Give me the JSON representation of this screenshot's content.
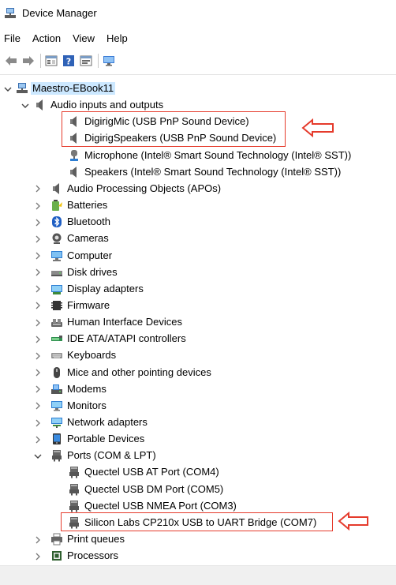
{
  "window": {
    "title": "Device Manager"
  },
  "menu": [
    "File",
    "Action",
    "View",
    "Help"
  ],
  "toolbar": [
    "back-arrow-icon",
    "forward-arrow-icon",
    "properties-icon",
    "help-icon",
    "show-hidden-icon",
    "monitor-icon"
  ],
  "tree": {
    "root": "Maestro-EBook11",
    "audio": {
      "label": "Audio inputs and outputs",
      "children": [
        "DigirigMic (USB PnP Sound Device)",
        "DigirigSpeakers (USB PnP Sound Device)",
        "Microphone (Intel® Smart Sound Technology (Intel® SST))",
        "Speakers (Intel® Smart Sound Technology (Intel® SST))"
      ]
    },
    "categories_a": [
      {
        "label": "Audio Processing Objects (APOs)",
        "icon": "speaker-icon"
      },
      {
        "label": "Batteries",
        "icon": "battery-icon"
      },
      {
        "label": "Bluetooth",
        "icon": "bluetooth-icon"
      },
      {
        "label": "Cameras",
        "icon": "camera-icon"
      },
      {
        "label": "Computer",
        "icon": "computer-icon"
      },
      {
        "label": "Disk drives",
        "icon": "disk-drive-icon"
      },
      {
        "label": "Display adapters",
        "icon": "display-adapter-icon"
      },
      {
        "label": "Firmware",
        "icon": "firmware-icon"
      },
      {
        "label": "Human Interface Devices",
        "icon": "hid-icon"
      },
      {
        "label": "IDE ATA/ATAPI controllers",
        "icon": "ide-controller-icon"
      },
      {
        "label": "Keyboards",
        "icon": "keyboard-icon"
      },
      {
        "label": "Mice and other pointing devices",
        "icon": "mouse-icon"
      },
      {
        "label": "Modems",
        "icon": "modem-icon"
      },
      {
        "label": "Monitors",
        "icon": "monitor-icon"
      },
      {
        "label": "Network adapters",
        "icon": "network-adapter-icon"
      },
      {
        "label": "Portable Devices",
        "icon": "portable-device-icon"
      }
    ],
    "ports": {
      "label": "Ports (COM & LPT)",
      "children": [
        "Quectel USB AT Port (COM4)",
        "Quectel USB DM Port (COM5)",
        "Quectel USB NMEA Port (COM3)",
        "Silicon Labs CP210x USB to UART Bridge (COM7)"
      ]
    },
    "categories_b": [
      {
        "label": "Print queues",
        "icon": "printer-icon"
      },
      {
        "label": "Processors",
        "icon": "processor-icon"
      }
    ]
  },
  "colors": {
    "highlight_box": "#e53b2c",
    "selection": "#cce8ff"
  }
}
